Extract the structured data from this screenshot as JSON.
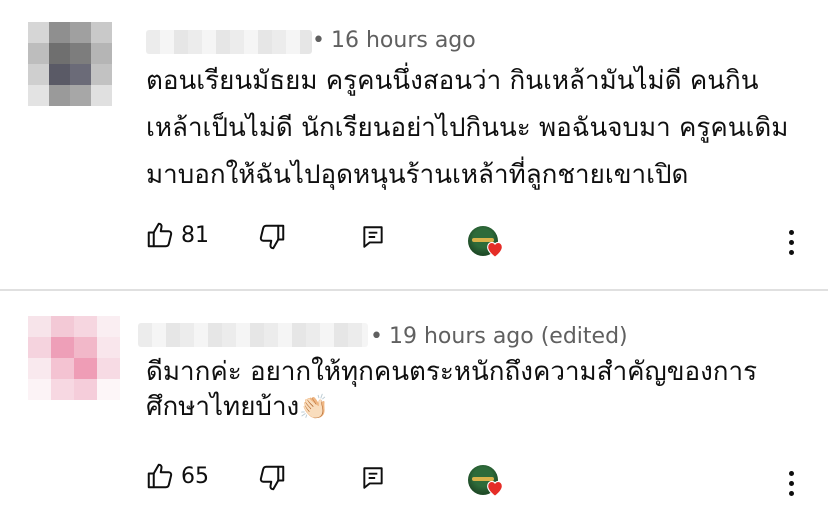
{
  "comments": [
    {
      "time": "16 hours ago",
      "lines": [
        "ตอนเรียนมัธยม ครูคนนึ่งสอนว่า กินเหล้ามันไม่ดี คนกิน",
        "เหล้าเป็นไม่ดี นักเรียนอย่าไปกินนะ พอฉันจบมา ครูคนเดิม",
        "มาบอกให้ฉันไปอุดหนุนร้านเหล้าที่ลูกชายเขาเปิด"
      ],
      "likes": "81"
    },
    {
      "time": "19 hours ago (edited)",
      "lines": [
        "ดีมากค่ะ อยากให้ทุกคนตระหนักถึงความสำคัญของการ",
        "ศึกษาไทยบ้าง"
      ],
      "emoji": "👏🏻",
      "likes": "65"
    }
  ],
  "icons": {
    "like": "thumbs-up-icon",
    "dislike": "thumbs-down-icon",
    "reply": "reply-icon",
    "creator_heart": "creator-heart-icon",
    "more": "more-vertical-icon"
  },
  "colors": {
    "heart": "#e52d27",
    "meta": "#606060",
    "text": "#0f0f0f"
  }
}
